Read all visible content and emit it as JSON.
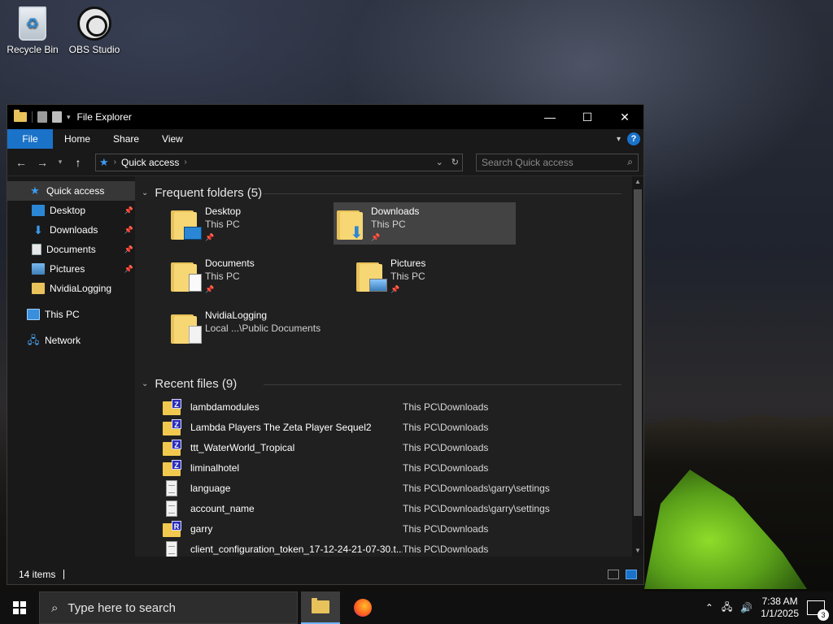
{
  "desktop": {
    "icons": [
      {
        "label": "Recycle Bin",
        "icon": "recycle-bin-icon"
      },
      {
        "label": "OBS Studio",
        "icon": "obs-studio-icon"
      }
    ]
  },
  "window": {
    "title": "File Explorer",
    "controls": {
      "minimize": "—",
      "maximize": "☐",
      "close": "✕"
    },
    "ribbon_tabs": [
      "File",
      "Home",
      "Share",
      "View"
    ],
    "accent": "#1a72c9"
  },
  "navbar": {
    "address_root": "Quick access",
    "search_placeholder": "Search Quick access"
  },
  "nav_pane": {
    "quick_access": "Quick access",
    "pinned": [
      {
        "label": "Desktop",
        "icon": "desktop-icon",
        "pinned": true
      },
      {
        "label": "Downloads",
        "icon": "downloads-icon",
        "pinned": true
      },
      {
        "label": "Documents",
        "icon": "documents-icon",
        "pinned": true
      },
      {
        "label": "Pictures",
        "icon": "pictures-icon",
        "pinned": true
      },
      {
        "label": "NvidiaLogging",
        "icon": "folder-icon",
        "pinned": false
      }
    ],
    "this_pc": "This PC",
    "network": "Network"
  },
  "frequent": {
    "header": "Frequent folders (5)",
    "items": [
      {
        "name": "Desktop",
        "location": "This PC",
        "pinned": true
      },
      {
        "name": "Downloads",
        "location": "This PC",
        "pinned": true,
        "selected": true
      },
      {
        "name": "Documents",
        "location": "This PC",
        "pinned": true
      },
      {
        "name": "Pictures",
        "location": "This PC",
        "pinned": true
      },
      {
        "name": "NvidiaLogging",
        "location": "Local ...\\Public Documents",
        "pinned": false
      }
    ]
  },
  "recent": {
    "header": "Recent files (9)",
    "items": [
      {
        "name": "lambdamodules",
        "path": "This PC\\Downloads",
        "type": "zip",
        "badge": "Z"
      },
      {
        "name": "Lambda Players The Zeta Player Sequel2",
        "path": "This PC\\Downloads",
        "type": "zip",
        "badge": "Z"
      },
      {
        "name": "ttt_WaterWorld_Tropical",
        "path": "This PC\\Downloads",
        "type": "zip",
        "badge": "Z"
      },
      {
        "name": "liminalhotel",
        "path": "This PC\\Downloads",
        "type": "zip",
        "badge": "Z"
      },
      {
        "name": "language",
        "path": "This PC\\Downloads\\garry\\settings",
        "type": "doc",
        "badge": ""
      },
      {
        "name": "account_name",
        "path": "This PC\\Downloads\\garry\\settings",
        "type": "doc",
        "badge": ""
      },
      {
        "name": "garry",
        "path": "This PC\\Downloads",
        "type": "zip",
        "badge": "R"
      },
      {
        "name": "client_configuration_token_17-12-24-21-07-30.t...",
        "path": "This PC\\Downloads",
        "type": "doc",
        "badge": ""
      }
    ]
  },
  "status": {
    "items": "14 items"
  },
  "taskbar": {
    "search_placeholder": "Type here to search",
    "time": "7:38 AM",
    "date": "1/1/2025",
    "notifications": "3"
  }
}
